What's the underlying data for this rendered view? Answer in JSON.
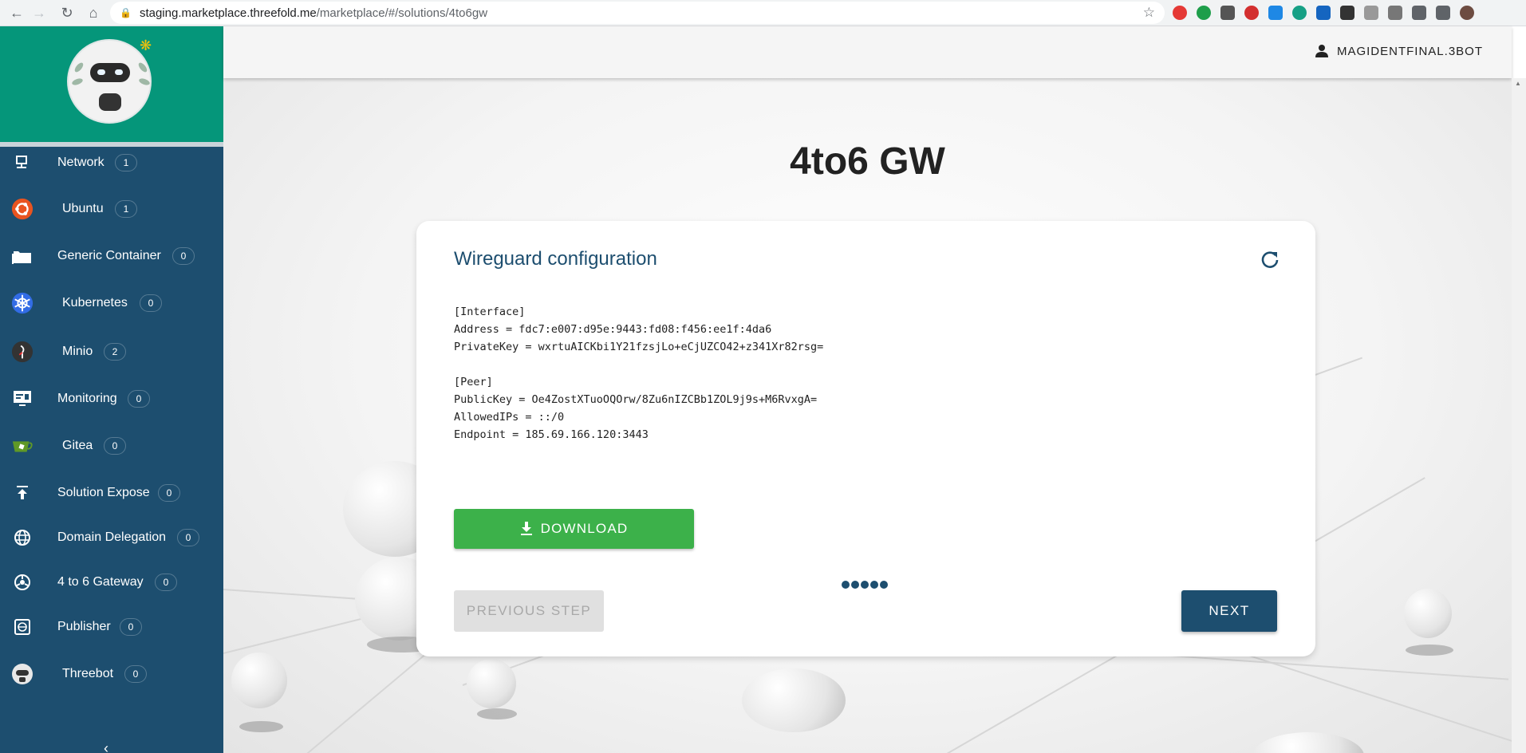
{
  "browser": {
    "url_host": "staging.marketplace.threefold.me",
    "url_path": "/marketplace/#/solutions/4to6gw"
  },
  "header": {
    "user": "MAGIDENTFINAL.3BOT"
  },
  "sidebar": {
    "items": [
      {
        "label": "Network",
        "count": "1",
        "icon": "network-icon"
      },
      {
        "label": "Ubuntu",
        "count": "1",
        "icon": "ubuntu-icon"
      },
      {
        "label": "Generic Container",
        "count": "0",
        "icon": "folder-icon"
      },
      {
        "label": "Kubernetes",
        "count": "0",
        "icon": "kubernetes-icon"
      },
      {
        "label": "Minio",
        "count": "2",
        "icon": "minio-icon"
      },
      {
        "label": "Monitoring",
        "count": "0",
        "icon": "monitor-icon"
      },
      {
        "label": "Gitea",
        "count": "0",
        "icon": "gitea-icon"
      },
      {
        "label": "Solution Expose",
        "count": "0",
        "icon": "upload-icon"
      },
      {
        "label": "Domain Delegation",
        "count": "0",
        "icon": "globe-icon"
      },
      {
        "label": "4 to 6 Gateway",
        "count": "0",
        "icon": "gateway-icon"
      },
      {
        "label": "Publisher",
        "count": "0",
        "icon": "publisher-icon"
      },
      {
        "label": "Threebot",
        "count": "0",
        "icon": "threebot-icon"
      }
    ]
  },
  "main": {
    "title": "4to6 GW",
    "card_title": "Wireguard configuration",
    "config_lines": [
      "[Interface]",
      "Address = fdc7:e007:d95e:9443:fd08:f456:ee1f:4da6",
      "PrivateKey = wxrtuAICKbi1Y21fzsjLo+eCjUZCO42+z341Xr82rsg=",
      "",
      "[Peer]",
      "PublicKey = Oe4ZostXTuoOQOrw/8Zu6nIZCBb1ZOL9j9s+M6RvxgA=",
      "AllowedIPs = ::/0",
      "Endpoint = 185.69.166.120:3443"
    ],
    "download_label": "DOWNLOAD",
    "prev_label": "PREVIOUS STEP",
    "next_label": "NEXT"
  },
  "colors": {
    "sidebar": "#1d4e6f",
    "logo_bg": "#05967a",
    "download": "#3cb14a",
    "primary": "#1d4e6f"
  }
}
